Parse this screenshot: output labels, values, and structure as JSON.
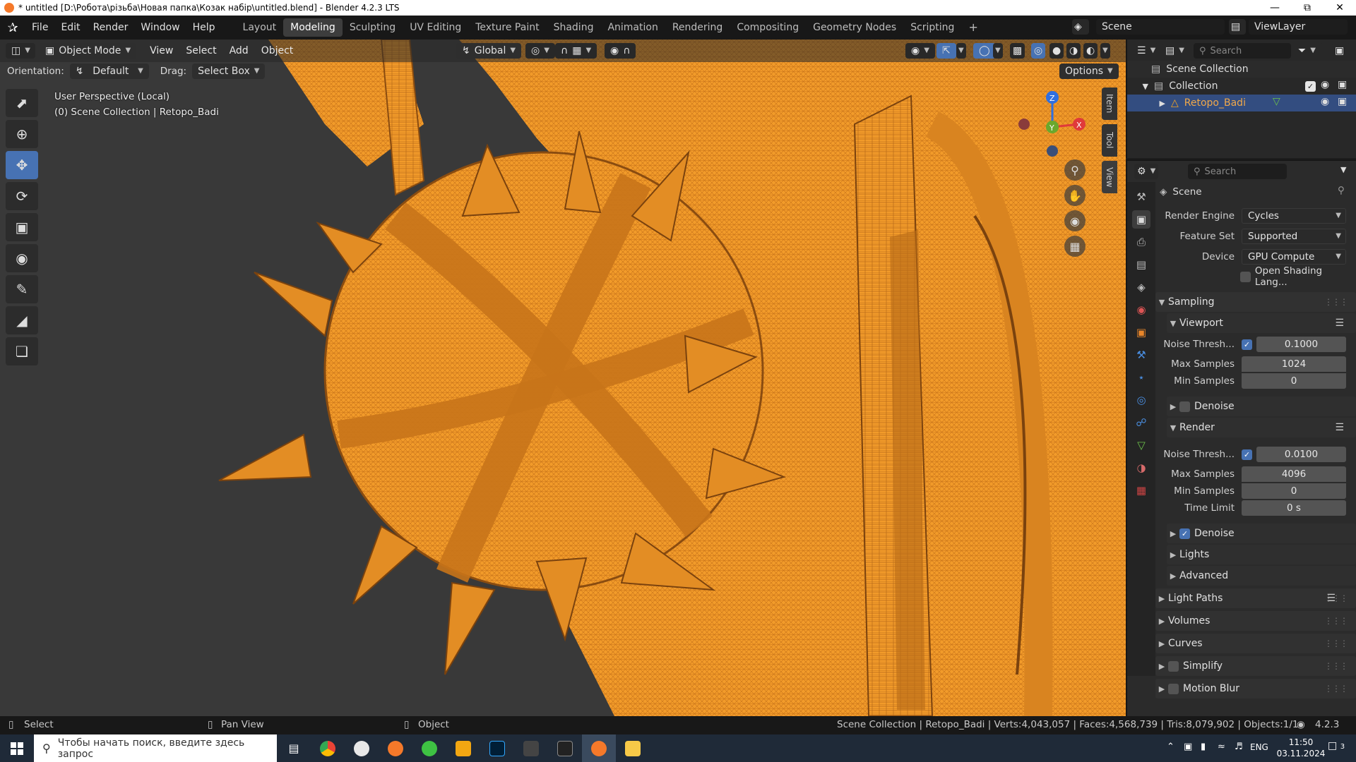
{
  "window": {
    "title": "* untitled [D:\\Робота\\різьба\\Новая папка\\Козак набір\\untitled.blend] - Blender 4.2.3 LTS"
  },
  "menu": {
    "file": "File",
    "edit": "Edit",
    "render": "Render",
    "window": "Window",
    "help": "Help"
  },
  "workspaces": [
    "Layout",
    "Modeling",
    "Sculpting",
    "UV Editing",
    "Texture Paint",
    "Shading",
    "Animation",
    "Rendering",
    "Compositing",
    "Geometry Nodes",
    "Scripting"
  ],
  "active_workspace": "Modeling",
  "scene_field": "Scene",
  "viewlayer_field": "ViewLayer",
  "viewport": {
    "mode": "Object Mode",
    "menus": [
      "View",
      "Select",
      "Add",
      "Object"
    ],
    "transform": "Global",
    "orientation_label": "Orientation:",
    "orientation_value": "Default",
    "drag_label": "Drag:",
    "drag_value": "Select Box",
    "options": "Options",
    "overlay_line1": "User Perspective (Local)",
    "overlay_line2": "(0) Scene Collection | Retopo_Badi",
    "side_tabs": [
      "Item",
      "Tool",
      "View"
    ],
    "gizmo_axes": {
      "z": "Z",
      "y": "Y",
      "x": "X"
    },
    "wire_color": "#f29b2a"
  },
  "outliner": {
    "search_placeholder": "Search",
    "scene_collection": "Scene Collection",
    "collection": "Collection",
    "object": "Retopo_Badi"
  },
  "properties": {
    "search_placeholder": "Search",
    "context": "Scene",
    "render_engine_label": "Render Engine",
    "render_engine": "Cycles",
    "feature_set_label": "Feature Set",
    "feature_set": "Supported",
    "device_label": "Device",
    "device": "GPU Compute",
    "osl_label": "Open Shading Lang...",
    "sampling": "Sampling",
    "viewport_sub": "Viewport",
    "vp_noise_label": "Noise Thresh...",
    "vp_noise": "0.1000",
    "vp_max_label": "Max Samples",
    "vp_max": "1024",
    "vp_min_label": "Min Samples",
    "vp_min": "0",
    "vp_denoise": "Denoise",
    "render_sub": "Render",
    "r_noise_label": "Noise Thresh...",
    "r_noise": "0.0100",
    "r_max_label": "Max Samples",
    "r_max": "4096",
    "r_min_label": "Min Samples",
    "r_min": "0",
    "r_time_label": "Time Limit",
    "r_time": "0 s",
    "r_denoise": "Denoise",
    "lights": "Lights",
    "advanced": "Advanced",
    "light_paths": "Light Paths",
    "volumes": "Volumes",
    "curves": "Curves",
    "simplify": "Simplify",
    "motion_blur": "Motion Blur"
  },
  "statusbar": {
    "select": "Select",
    "pan": "Pan View",
    "object": "Object",
    "info": "Scene Collection | Retopo_Badi | Verts:4,043,057 | Faces:4,568,739 | Tris:8,079,902 | Objects:1/1",
    "version": "4.2.3"
  },
  "taskbar": {
    "search_placeholder": "Чтобы начать поиск, введите здесь запрос",
    "lang": "ENG",
    "time": "11:50",
    "date": "03.11.2024",
    "notifications": "3"
  }
}
